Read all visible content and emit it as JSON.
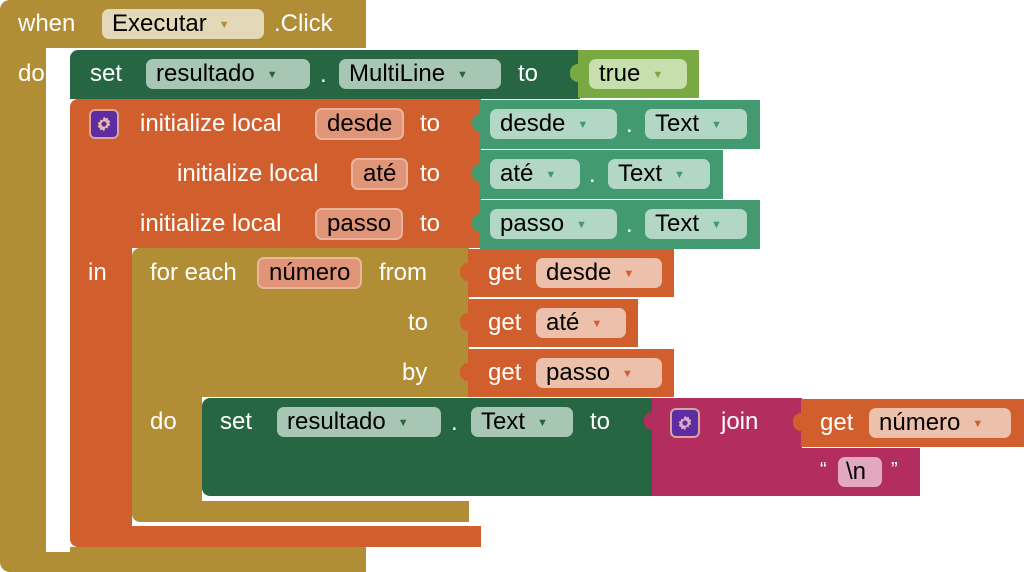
{
  "event": {
    "when_label": "when",
    "component": "Executar",
    "event_name": ".Click",
    "do_label": "do"
  },
  "set_multiline": {
    "set_label": "set",
    "component": "resultado",
    "dot": ".",
    "property": "MultiLine",
    "to_label": "to",
    "value": "true"
  },
  "locals": {
    "init_label": "initialize local",
    "to_label": "to",
    "in_label": "in",
    "vars": [
      {
        "name": "desde",
        "component": "desde",
        "property": "Text"
      },
      {
        "name": "até",
        "component": "até",
        "property": "Text"
      },
      {
        "name": "passo",
        "component": "passo",
        "property": "Text"
      }
    ],
    "dot": "."
  },
  "for_range": {
    "for_each_label": "for each",
    "var_name": "número",
    "from_label": "from",
    "to_label": "to",
    "by_label": "by",
    "do_label": "do",
    "get_label": "get",
    "from_var": "desde",
    "to_var": "até",
    "by_var": "passo"
  },
  "set_text": {
    "set_label": "set",
    "component": "resultado",
    "dot": ".",
    "property": "Text",
    "to_label": "to"
  },
  "join": {
    "label": "join",
    "get_label": "get",
    "get_var": "número",
    "open_quote": "“",
    "string_value": "\\n",
    "close_quote": "”"
  },
  "colors": {
    "control": "#b18e35",
    "setter": "#266643",
    "variables": "#d05f2d",
    "component": "#439970",
    "logic": "#78a942",
    "text": "#b32d5e",
    "mutator": "#5c2ca0"
  }
}
